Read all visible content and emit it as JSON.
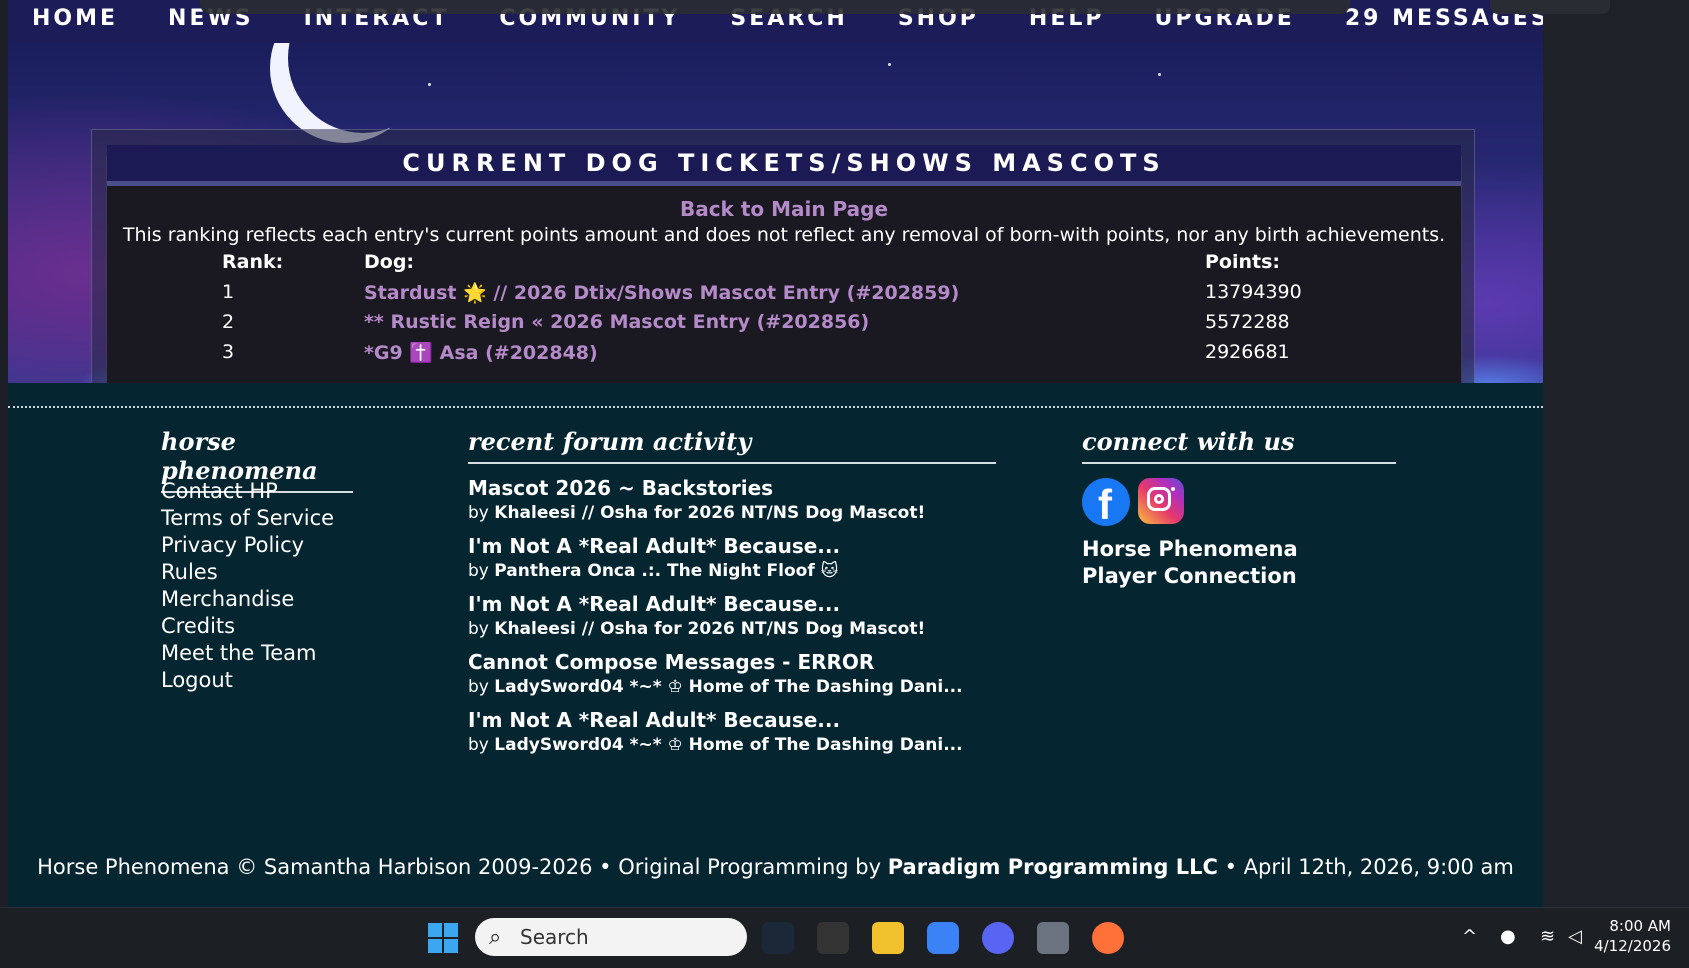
{
  "nav": {
    "items": [
      "HOME",
      "NEWS",
      "INTERACT",
      "COMMUNITY",
      "SEARCH",
      "SHOP",
      "HELP",
      "UPGRADE",
      "29 MESSAGES"
    ]
  },
  "ranking": {
    "title": "CURRENT DOG TICKETS/SHOWS MASCOTS",
    "back_link": "Back to Main Page",
    "note": "This ranking reflects each entry's current points amount and does not reflect any removal of born-with points, nor any birth achievements.",
    "headers": {
      "rank": "Rank:",
      "dog": "Dog:",
      "points": "Points:"
    },
    "rows": [
      {
        "rank": "1",
        "dog": "Stardust 🌟 // 2026 Dtix/Shows Mascot Entry (#202859)",
        "points": "13794390"
      },
      {
        "rank": "2",
        "dog": "** Rustic Reign « 2026 Mascot Entry (#202856)",
        "points": "5572288"
      },
      {
        "rank": "3",
        "dog": "*G9 ✝️ Asa (#202848)",
        "points": "2926681"
      }
    ]
  },
  "footer": {
    "col1_heading": "horse phenomena",
    "links": [
      "Contact HP",
      "Terms of Service",
      "Privacy Policy",
      "Rules",
      "Merchandise",
      "Credits",
      "Meet the Team",
      "Logout"
    ],
    "col2_heading": "recent forum activity",
    "forum": [
      {
        "topic": "Mascot 2026 ~ Backstories",
        "by": "by",
        "author": "Khaleesi // Osha for 2026 NT/NS Dog Mascot!"
      },
      {
        "topic": "I'm Not A *Real Adult* Because...",
        "by": "by",
        "author": "Panthera Onca .:. The Night Floof 🐱"
      },
      {
        "topic": "I'm Not A *Real Adult* Because...",
        "by": "by",
        "author": "Khaleesi // Osha for 2026 NT/NS Dog Mascot!"
      },
      {
        "topic": "Cannot Compose Messages - ERROR",
        "by": "by",
        "author": "LadySword04 *~* ♔ Home of The Dashing Dani..."
      },
      {
        "topic": "I'm Not A *Real Adult* Because...",
        "by": "by",
        "author": "LadySword04 *~* ♔ Home of The Dashing Dani..."
      }
    ],
    "col3_heading": "connect with us",
    "social_text": "Horse Phenomena Player Connection",
    "copyright_pre": "Horse Phenomena © Samantha Harbison 2009-2026  •  Original Programming by ",
    "copyright_bold": "Paradigm Programming LLC",
    "copyright_post": "  •  April 12th, 2026, 9:00 am"
  },
  "taskbar": {
    "search_placeholder": "Search",
    "time": "8:00 AM",
    "date": "4/12/2026"
  }
}
